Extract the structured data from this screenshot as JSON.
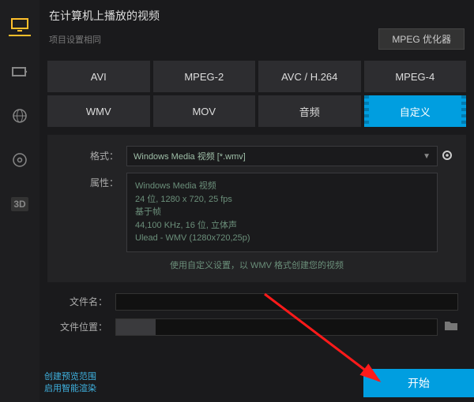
{
  "header": {
    "title": "在计算机上播放的视频",
    "subtitle": "项目设置相同",
    "optimize_btn": "MPEG 优化器"
  },
  "tabs": [
    {
      "label": "AVI"
    },
    {
      "label": "MPEG-2"
    },
    {
      "label": "AVC / H.264"
    },
    {
      "label": "MPEG-4"
    },
    {
      "label": "WMV"
    },
    {
      "label": "MOV"
    },
    {
      "label": "音频"
    },
    {
      "label": "自定义"
    }
  ],
  "panel": {
    "format_label": "格式：",
    "format_value": "Windows Media 视频 [*.wmv]",
    "attr_label": "属性：",
    "attr_lines": "Windows Media 视频\n24 位, 1280 x 720, 25 fps\n基于帧\n44,100 KHz, 16 位, 立体声\nUlead - WMV (1280x720,25p)",
    "hint": "使用自定义设置，以 WMV 格式创建您的视频"
  },
  "file": {
    "name_label": "文件名：",
    "location_label": "文件位置："
  },
  "footer": {
    "line1": "创建预览范围",
    "line2": "启用智能渲染",
    "start_btn": "开始"
  },
  "icons": {
    "monitor": "monitor-icon",
    "phone": "phone-icon",
    "globe": "globe-icon",
    "disc": "disc-icon",
    "threeD": "3d-icon",
    "gear": "gear-icon",
    "folder": "folder-icon",
    "arrow": "dropdown-arrow-icon"
  }
}
